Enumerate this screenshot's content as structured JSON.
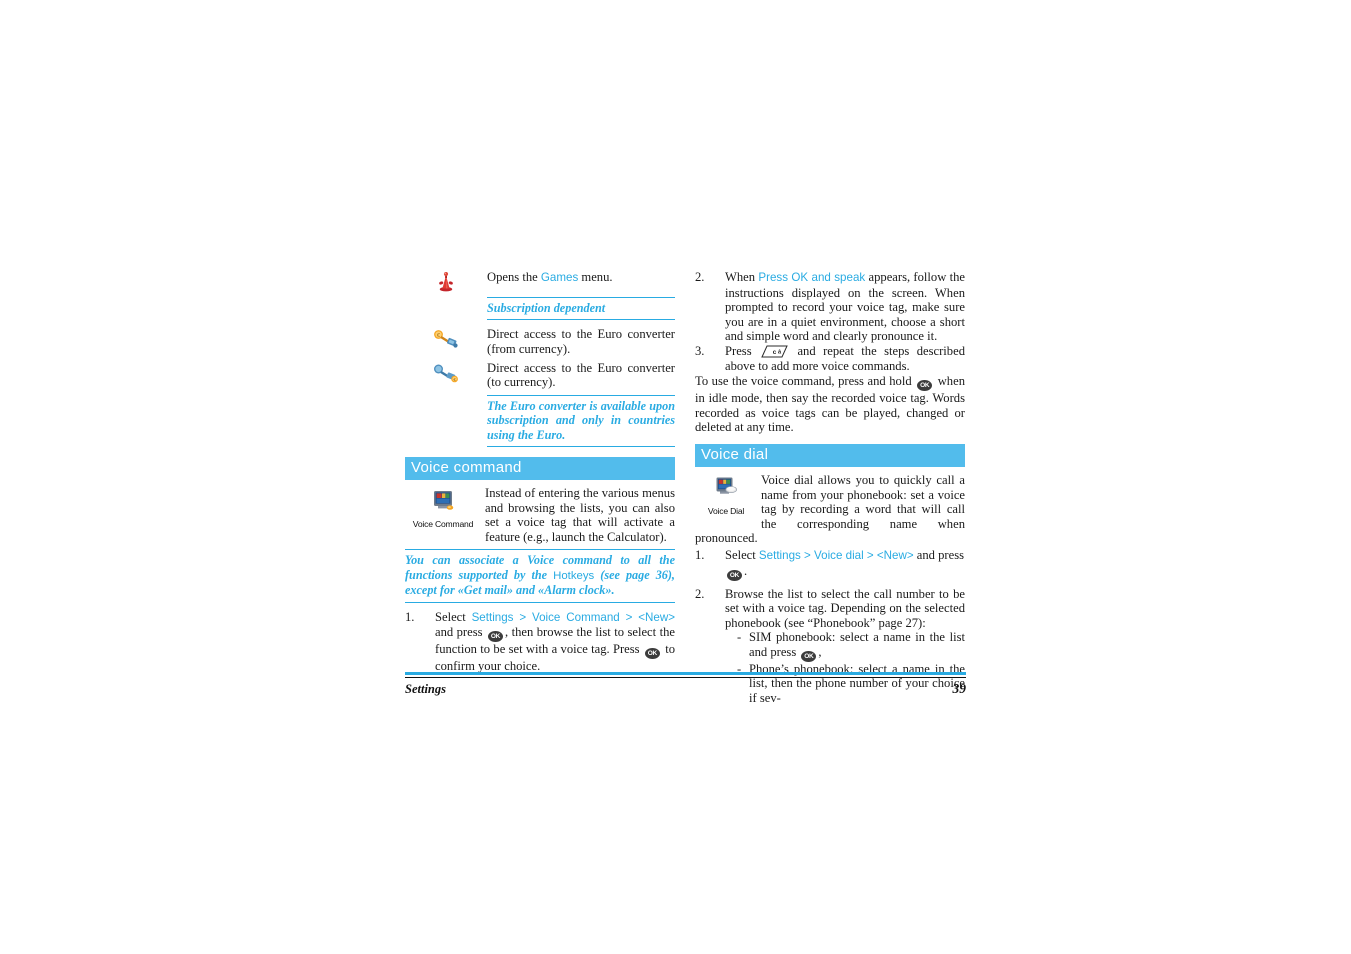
{
  "document": {
    "page_number": "39",
    "footer_section": "Settings",
    "accent_color": "#29ABE2",
    "header_bar_color": "#52BCEC"
  },
  "left_column": {
    "hotkey_items": [
      {
        "icon": "joystick-games-icon",
        "text_before": "Opens the ",
        "link": "Games",
        "text_after": " menu."
      },
      {
        "icon": "euro-converter-from-icon",
        "text": "Direct access to the Euro converter (from currency)."
      },
      {
        "icon": "euro-converter-to-icon",
        "text": "Direct access to the Euro converter (to currency)."
      }
    ],
    "note_subscription": "Subscription dependent",
    "note_euro": "The Euro converter is available upon subscription and only in countries using the Euro.",
    "section": {
      "title": "Voice command",
      "icon": "voice-command-icon",
      "icon_caption": "Voice Command",
      "description": "Instead of entering the various menus and browsing the lists, you can also set a voice tag that will activate a feature (e.g., launch the Calculator).",
      "note_part1": "You can associate a Voice command to all the functions supported by the ",
      "note_hotkeys": "Hotkeys",
      "note_part2": " (see page 36), except for «Get mail» and «Alarm clock».",
      "steps": [
        {
          "marker": "1.",
          "seg1": "Select ",
          "link1": "Settings",
          "sep1": " > ",
          "link2": "Voice Command",
          "sep2": " > ",
          "link3": "<New>",
          "seg2": " and press ",
          "key1": "OK",
          "seg3": ", then browse the list to select the function to be set with a voice tag. Press ",
          "key2": "OK",
          "seg4": " to confirm your choice."
        }
      ]
    }
  },
  "right_column": {
    "steps_continued": [
      {
        "marker": "2.",
        "seg1": "When ",
        "link1": "Press OK and speak",
        "seg2": " appears, follow the instructions displayed on the screen. When prompted to record your voice tag, make sure you are in a quiet environment, choose a short and simple word and clearly pronounce it."
      },
      {
        "marker": "3.",
        "seg1": "Press ",
        "key1": "C",
        "seg2": " and repeat the steps described above to add more voice commands."
      }
    ],
    "closing_paragraph_1": "To use the voice command, press and hold ",
    "closing_key": "OK",
    "closing_paragraph_2": " when in idle mode, then say the recorded voice tag. Words recorded as voice tags can be played, changed or deleted at any time.",
    "section": {
      "title": "Voice dial",
      "icon": "voice-dial-icon",
      "icon_caption": "Voice Dial",
      "description": "Voice dial allows you to quickly call a name from your phonebook: set a voice tag by recording a word that will call the corresponding name when pronounced.",
      "steps": [
        {
          "marker": "1.",
          "seg1": "Select ",
          "link1": "Settings",
          "sep1": " > ",
          "link2": "Voice dial",
          "sep2": " > ",
          "link3": "<New>",
          "seg2": " and press ",
          "key1": "OK",
          "seg3": "."
        },
        {
          "marker": "2.",
          "seg1": "Browse the list to select the call number to be set with a voice tag. Depending on the selected phonebook (see “Phonebook” page 27):",
          "sub_items": [
            {
              "dash": "-",
              "seg1": "SIM phonebook: select a name in the list and press ",
              "key1": "OK",
              "seg2": ","
            },
            {
              "dash": "-",
              "seg1": "Phone’s phonebook: select a name in the list, then the phone number of your choice if sev-"
            }
          ]
        }
      ]
    }
  }
}
